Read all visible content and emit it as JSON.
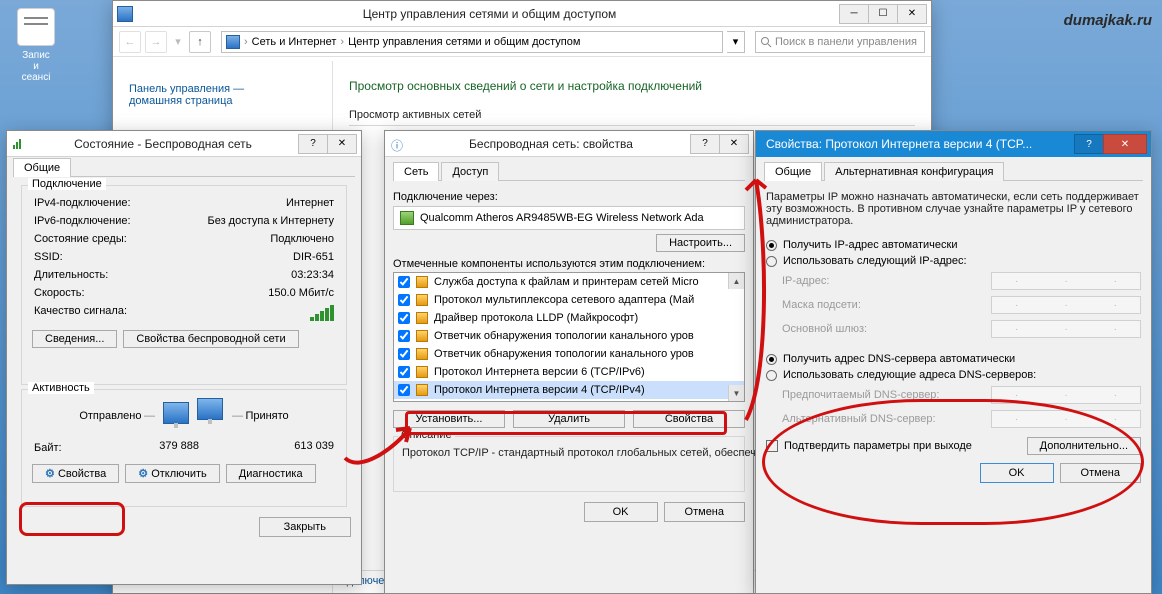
{
  "watermark": "dumajkak.ru",
  "desktop": {
    "label": "Запис\nи\nсеансі"
  },
  "cp": {
    "title": "Центр управления сетями и общим доступом",
    "bc1": "Сеть и Интернет",
    "bc2": "Центр управления сетями и общим доступом",
    "search_ph": "Поиск в панели управления",
    "side1": "Панель управления —",
    "side2": "домашняя страница",
    "h1": "Просмотр основных сведений о сети и настройка подключений",
    "sub": "Просмотр активных сетей",
    "foot": "Подключение к беспроводным сетям"
  },
  "status": {
    "title": "Состояние - Беспроводная сеть",
    "tab": "Общие",
    "group1": "Подключение",
    "rows": {
      "ipv4_l": "IPv4-подключение:",
      "ipv4_v": "Интернет",
      "ipv6_l": "IPv6-подключение:",
      "ipv6_v": "Без доступа к Интернету",
      "media_l": "Состояние среды:",
      "media_v": "Подключено",
      "ssid_l": "SSID:",
      "ssid_v": "DIR-651",
      "dur_l": "Длительность:",
      "dur_v": "03:23:34",
      "speed_l": "Скорость:",
      "speed_v": "150.0 Мбит/с",
      "sig_l": "Качество сигнала:"
    },
    "details": "Сведения...",
    "wprops": "Свойства беспроводной сети",
    "group2": "Активность",
    "sent": "Отправлено",
    "recv": "Принято",
    "bytes_l": "Байт:",
    "bytes_sent": "379 888",
    "bytes_recv": "613 039",
    "props": "Свойства",
    "disable": "Отключить",
    "diag": "Диагностика",
    "close": "Закрыть"
  },
  "adapter": {
    "title": "Беспроводная сеть: свойства",
    "tabs": [
      "Сеть",
      "Доступ"
    ],
    "conn_lbl": "Подключение через:",
    "conn_val": "Qualcomm Atheros AR9485WB-EG Wireless Network Ada",
    "configure": "Настроить...",
    "comps_lbl": "Отмеченные компоненты используются этим подключением:",
    "items": [
      "Служба доступа к файлам и принтерам сетей Micro",
      "Протокол мультиплексора сетевого адаптера (Май",
      "Драйвер протокола LLDP (Майкрософт)",
      "Ответчик обнаружения топологии канального уров",
      "Ответчик обнаружения топологии канального уров",
      "Протокол Интернета версии 6 (TCP/IPv6)",
      "Протокол Интернета версии 4 (TCP/IPv4)"
    ],
    "install": "Установить...",
    "remove": "Удалить",
    "props": "Свойства",
    "desc_lbl": "Описание",
    "desc": "Протокол TCP/IP - стандартный протокол глобальных сетей, обеспечивающий связь между различными взаимодействующими сетями.",
    "ok": "OK",
    "cancel": "Отмена"
  },
  "ipv4": {
    "title": "Свойства: Протокол Интернета версии 4 (TCP...",
    "tabs": [
      "Общие",
      "Альтернативная конфигурация"
    ],
    "info": "Параметры IP можно назначать автоматически, если сеть поддерживает эту возможность. В противном случае узнайте параметры IP у сетевого администратора.",
    "r1": "Получить IP-адрес автоматически",
    "r2": "Использовать следующий IP-адрес:",
    "ip_l": "IP-адрес:",
    "mask_l": "Маска подсети:",
    "gw_l": "Основной шлюз:",
    "r3": "Получить адрес DNS-сервера автоматически",
    "r4": "Использовать следующие адреса DNS-серверов:",
    "dns1_l": "Предпочитаемый DNS-сервер:",
    "dns2_l": "Альтернативный DNS-сервер:",
    "confirm": "Подтвердить параметры при выходе",
    "adv": "Дополнительно...",
    "ok": "OK",
    "cancel": "Отмена"
  }
}
